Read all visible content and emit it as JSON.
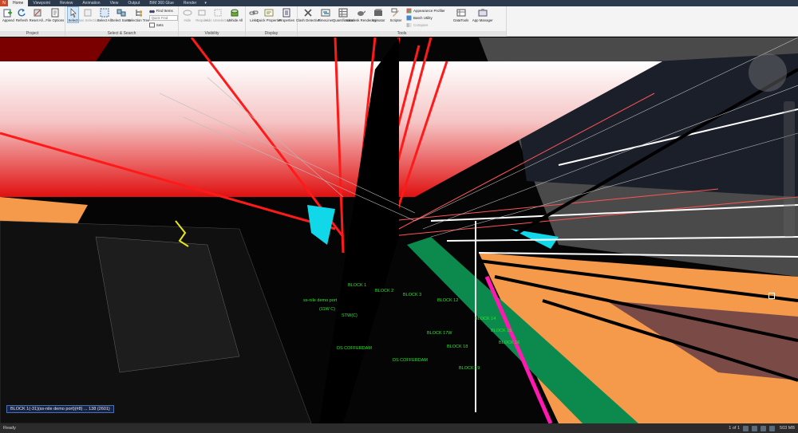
{
  "app_menu_label": "N",
  "tabs": [
    {
      "label": "Home",
      "active": true
    },
    {
      "label": "Viewpoint"
    },
    {
      "label": "Review"
    },
    {
      "label": "Animation"
    },
    {
      "label": "View"
    },
    {
      "label": "Output"
    },
    {
      "label": "BIM 360 Glue"
    },
    {
      "label": "Render"
    }
  ],
  "tab_extra": "▾",
  "ribbon": {
    "project": {
      "title": "Project",
      "append": "Append",
      "refresh": "Refresh",
      "reset_all": "Reset All...",
      "file_options": "File Options"
    },
    "select_search": {
      "title": "Select & Search",
      "select": "Select",
      "save_selection": "Save Selection",
      "select_all": "Select All",
      "select_same": "Select Same",
      "selection_tree": "Selection Tree",
      "find_items": "Find Items",
      "quick_find_placeholder": "Quick Find",
      "sets": "Sets"
    },
    "visibility": {
      "title": "Visibility",
      "hide": "Hide",
      "require": "Require",
      "hide_unselected": "Hide Unselected",
      "unhide_all": "Unhide All"
    },
    "display": {
      "title": "Display",
      "links": "Links",
      "quick_properties": "Quick Properties",
      "properties": "Properties"
    },
    "tools": {
      "title": "Tools",
      "clash_detective": "Clash Detective",
      "timeliner": "TimeLiner",
      "quantification": "Quantification",
      "autodesk_rendering": "Autodesk Rendering",
      "animator": "Animator",
      "scripter": "Scripter",
      "appearance_profiler": "Appearance Profiler",
      "batch_utility": "Batch Utility",
      "compare": "Compare",
      "datatools": "DataTools",
      "app_manager": "App Manager"
    }
  },
  "viewport": {
    "labels": [
      "BLOCK 1",
      "BLOCK 2",
      "BLOCK 3",
      "BLOCK 12",
      "ss-nile demo port",
      "(11W C)",
      "STW(C)",
      "BLOCK 14",
      "BLOCK 15",
      "BLOCK 16",
      "DS COFFERDAM",
      "DS COFFERDAM",
      "BLOCK 17W",
      "BLOCK 18",
      "BLOCK 19"
    ],
    "hover_tip": "BLOCK 1(-31)(ss-nile demo port)(#8)   ...   138 (2601)"
  },
  "status": {
    "left": "Ready",
    "page": "1 of 1",
    "memory": "503 MB"
  },
  "colors": {
    "ribbon_bg": "#f4f4f4",
    "tabbar_bg": "#2b3a4c",
    "label_green": "#2ee52e",
    "accent_red": "#ff1a1a",
    "accent_orange": "#f49a4a"
  }
}
